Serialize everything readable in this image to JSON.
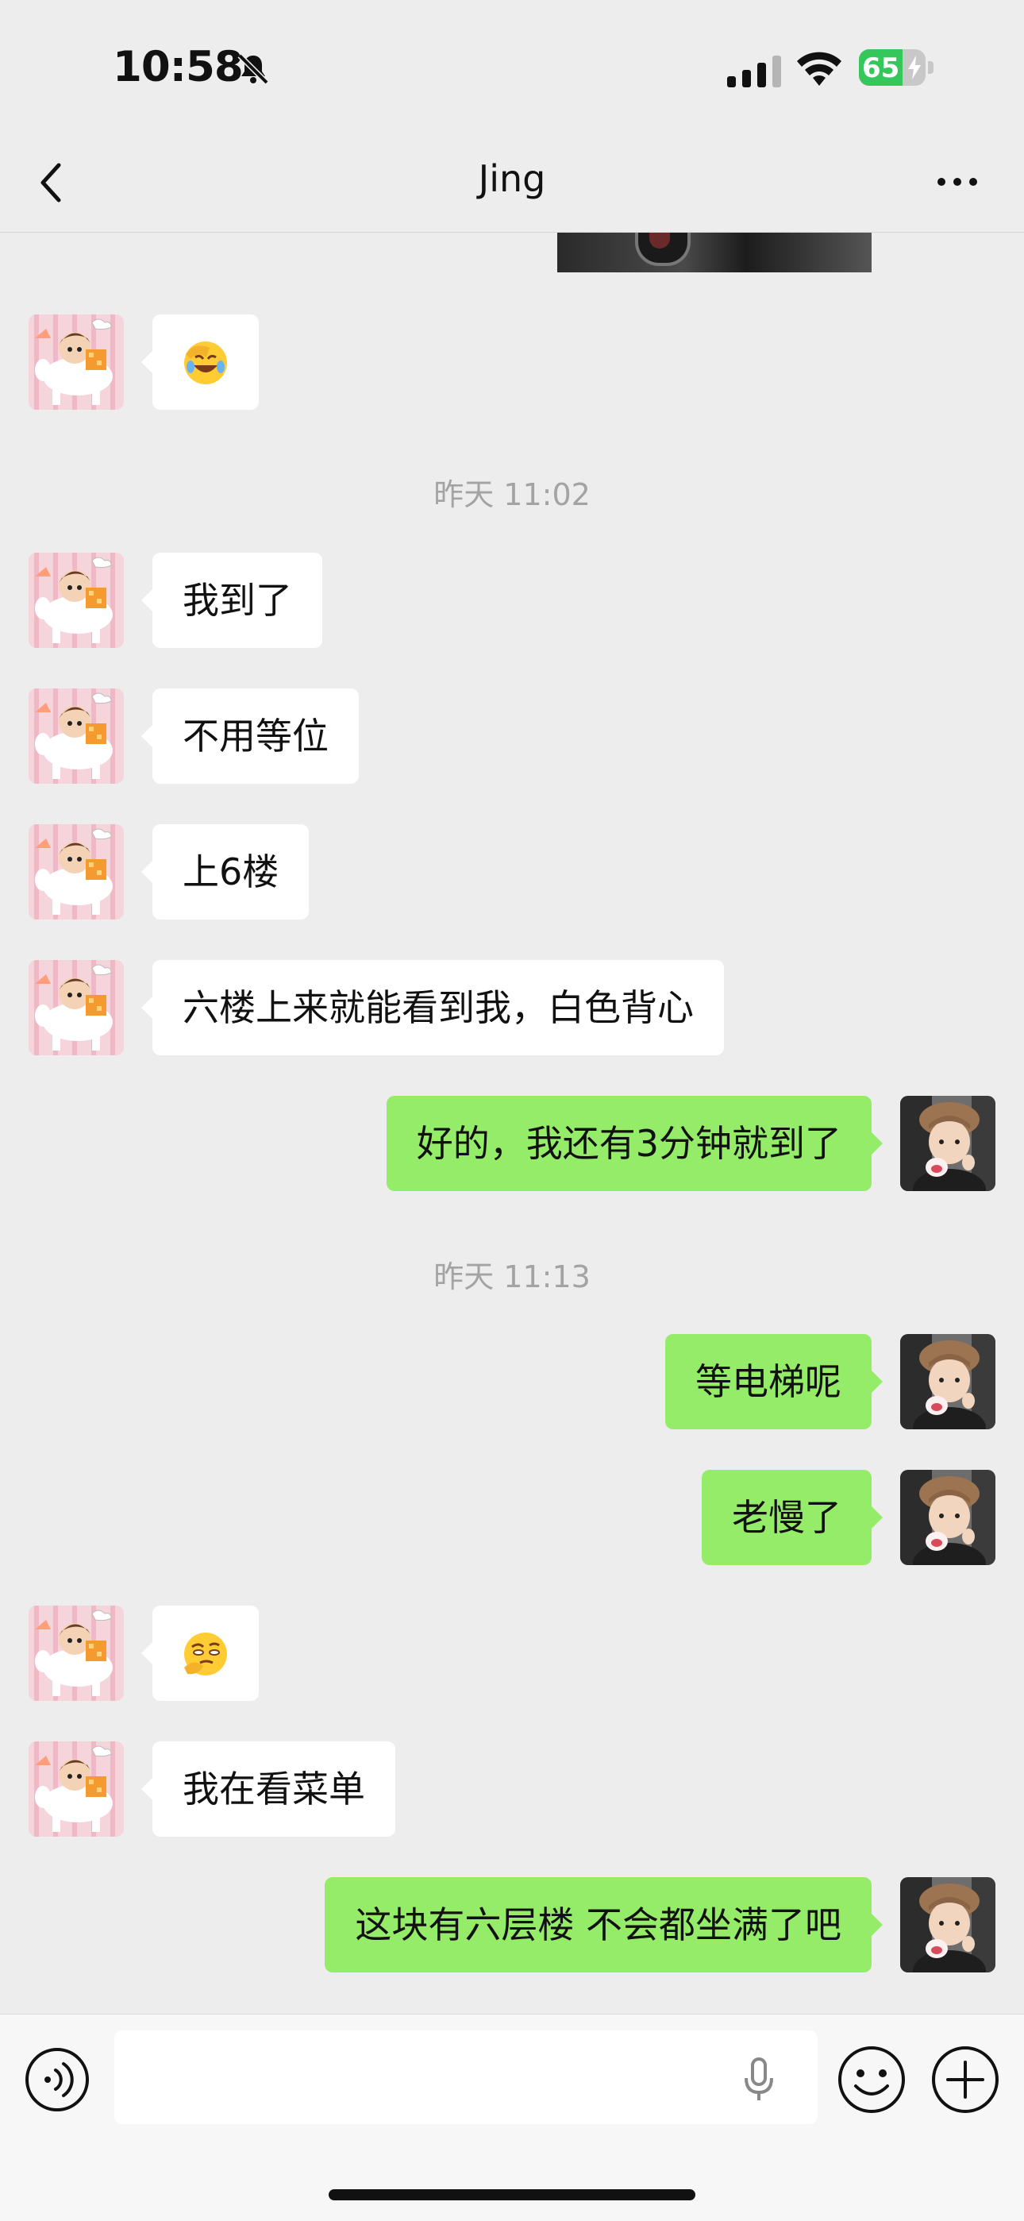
{
  "status_bar": {
    "time": "10:58",
    "battery": "65",
    "battery_level": 0.65
  },
  "header": {
    "title": "Jing"
  },
  "messages": [
    {
      "kind": "incoming",
      "emoji": "face-with-hand-over-eyes-laughing"
    },
    {
      "kind": "time",
      "text": "昨天 11:02"
    },
    {
      "kind": "incoming",
      "text": "我到了"
    },
    {
      "kind": "incoming",
      "text": "不用等位"
    },
    {
      "kind": "incoming",
      "text": "上6楼"
    },
    {
      "kind": "incoming",
      "text": "六楼上来就能看到我，白色背心"
    },
    {
      "kind": "outgoing",
      "text": "好的，我还有3分钟就到了"
    },
    {
      "kind": "time",
      "text": "昨天 11:13"
    },
    {
      "kind": "outgoing",
      "text": "等电梯呢"
    },
    {
      "kind": "outgoing",
      "text": "老慢了"
    },
    {
      "kind": "incoming",
      "emoji": "thinking-face-with-hand"
    },
    {
      "kind": "incoming",
      "text": "我在看菜单"
    },
    {
      "kind": "outgoing",
      "text": "这块有六层楼 不会都坐满了吧"
    }
  ],
  "input": {
    "value": ""
  },
  "colors": {
    "background": "#ededed",
    "outgoing_bubble": "#95ec69",
    "incoming_bubble": "#ffffff",
    "battery": "#35c759"
  }
}
